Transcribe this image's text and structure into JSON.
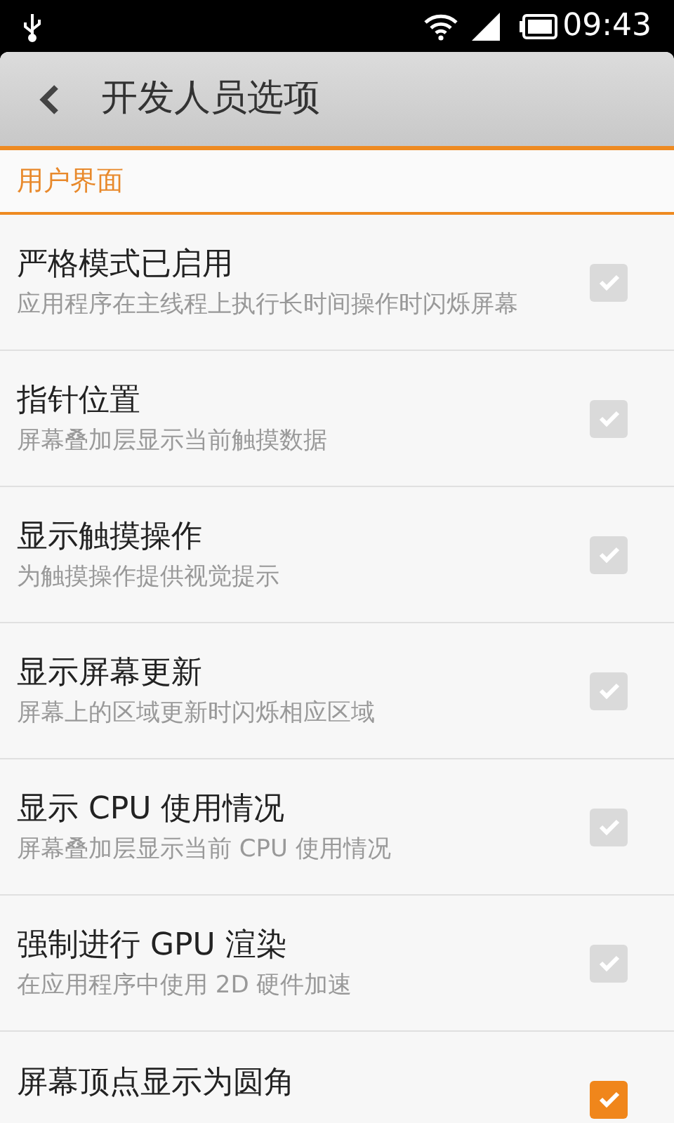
{
  "status_bar": {
    "time": "09:43"
  },
  "header": {
    "title": "开发人员选项"
  },
  "section": {
    "title": "用户界面"
  },
  "items": [
    {
      "title": "严格模式已启用",
      "subtitle": "应用程序在主线程上执行长时间操作时闪烁屏幕",
      "checked": false
    },
    {
      "title": "指针位置",
      "subtitle": "屏幕叠加层显示当前触摸数据",
      "checked": false
    },
    {
      "title": "显示触摸操作",
      "subtitle": "为触摸操作提供视觉提示",
      "checked": false
    },
    {
      "title": "显示屏幕更新",
      "subtitle": "屏幕上的区域更新时闪烁相应区域",
      "checked": false
    },
    {
      "title": "显示 CPU 使用情况",
      "subtitle": "屏幕叠加层显示当前 CPU 使用情况",
      "checked": false
    },
    {
      "title": "强制进行 GPU 渲染",
      "subtitle": "在应用程序中使用 2D 硬件加速",
      "checked": false
    },
    {
      "title": "屏幕顶点显示为圆角",
      "checked": true
    }
  ]
}
